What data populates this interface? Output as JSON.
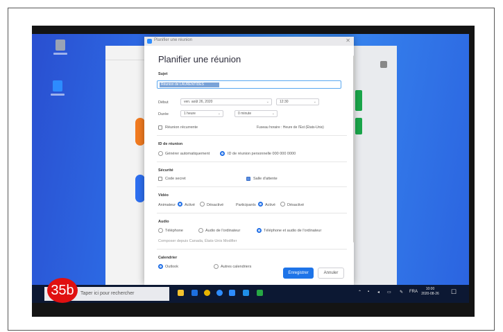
{
  "badge": "35b",
  "dialog": {
    "window_title": "Planifier une réunion",
    "heading": "Planifier une réunion",
    "topic_label": "Sujet",
    "topic_value": "Réunion de LAURENTIDES",
    "date_label": "Début",
    "date_value": "ven. août 26, 2020",
    "time_value": "12:30",
    "duration_label": "Durée",
    "duration_hours": "1 heure",
    "duration_minutes": "0 minute",
    "recurring_label": "Réunion récurrente",
    "timezone_text": "Fuseau horaire : Heure de l'Est (États-Unis)",
    "meeting_id_label": "ID de réunion",
    "meeting_id_auto": "Générer automatiquement",
    "meeting_id_personal": "ID de réunion personnelle 000 000 0000",
    "security_label": "Sécurité",
    "passcode_label": "Code secret",
    "waiting_room_label": "Salle d'attente",
    "video_label": "Vidéo",
    "host_label": "Animateur",
    "host_on": "Activé",
    "host_off": "Désactivé",
    "participants_label": "Participants",
    "participants_on": "Activé",
    "participants_off": "Désactivé",
    "audio_label": "Audio",
    "audio_phone": "Téléphone",
    "audio_computer": "Audio de l'ordinateur",
    "audio_both": "Téléphone et audio de l'ordinateur",
    "dial_text": "Composer depuis Canada, États-Unis   Modifier",
    "calendar_label": "Calendrier",
    "calendar_outlook": "Outlook",
    "calendar_other": "Autres calendriers",
    "save_button": "Enregistrer",
    "cancel_button": "Annuler"
  },
  "taskbar": {
    "search_placeholder": "Taper ici pour rechercher",
    "time": "10:00",
    "date": "2020-08-26",
    "lang": "FRA"
  },
  "colors": {
    "accent": "#1e74e8",
    "badge": "#e01010"
  }
}
